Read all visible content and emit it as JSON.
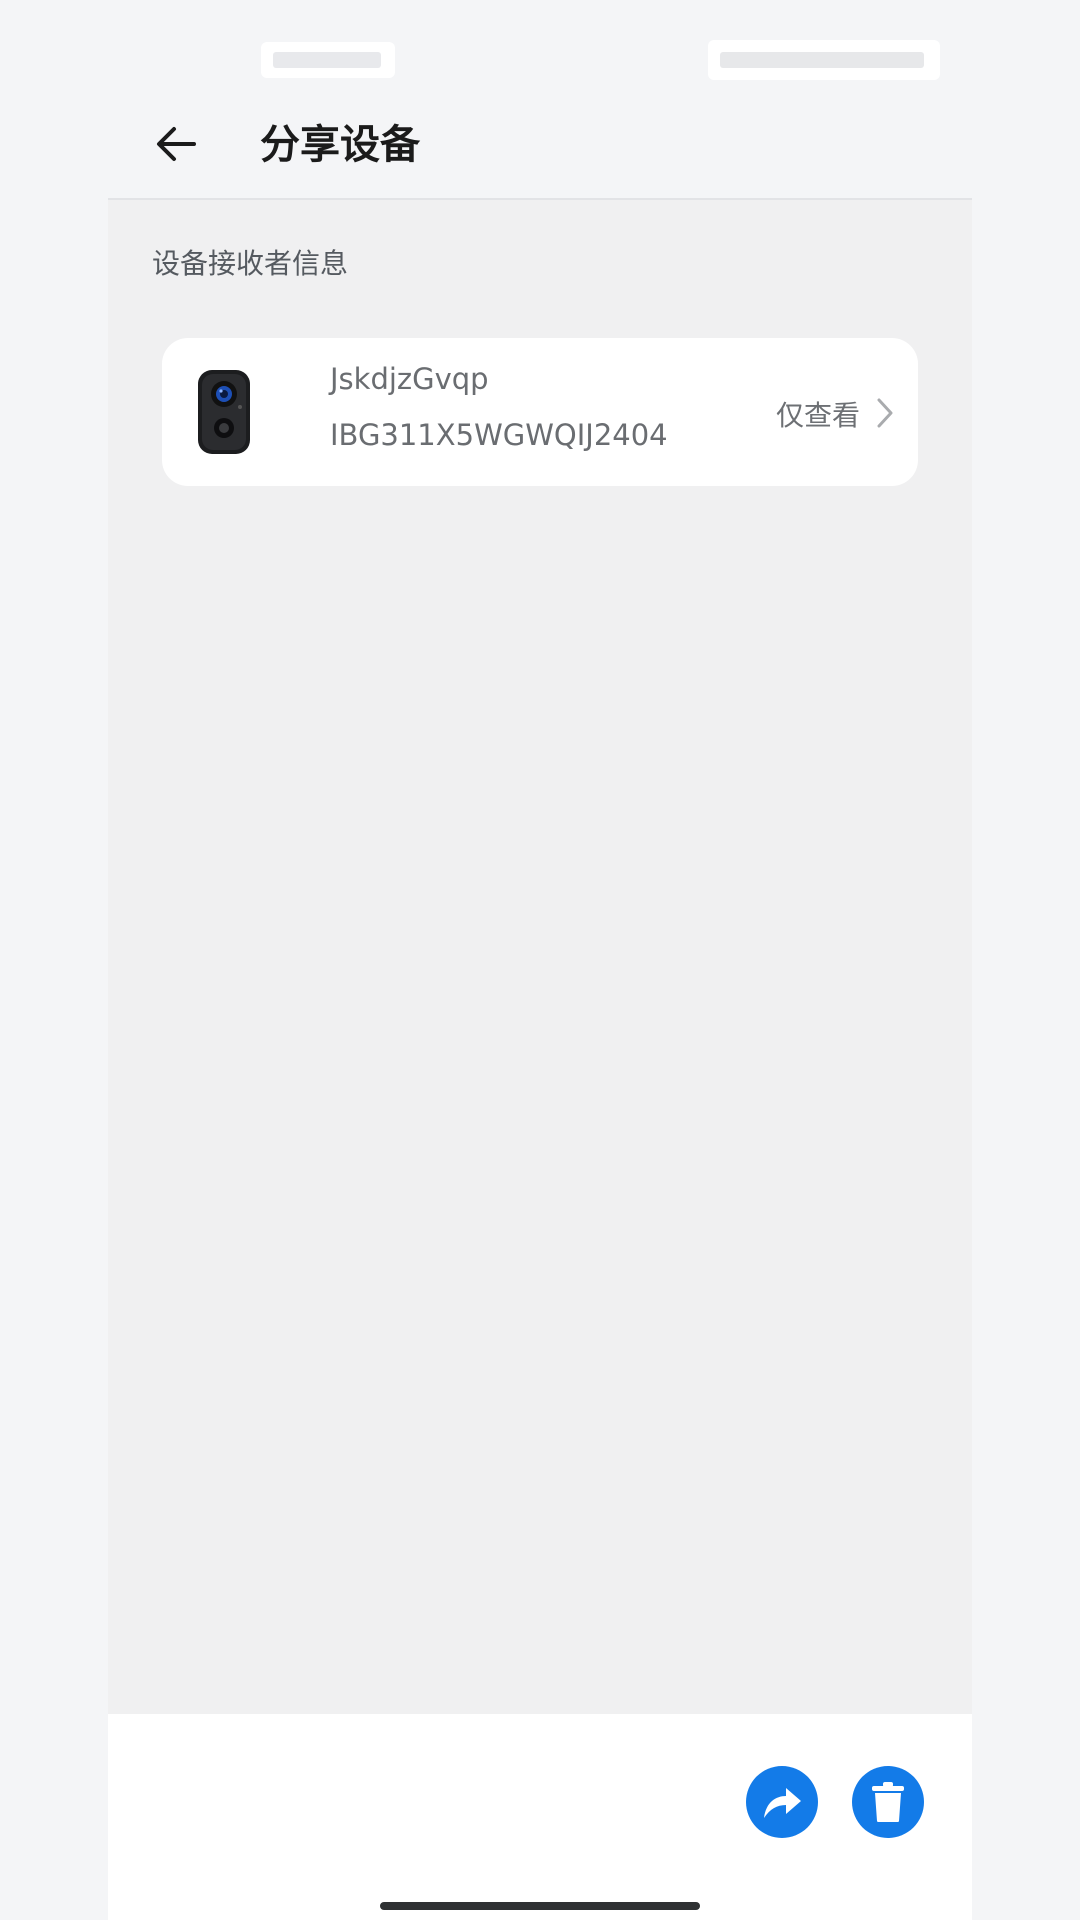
{
  "header": {
    "title": "分享设备",
    "back_icon": "arrow-left-icon"
  },
  "section": {
    "label": "设备接收者信息"
  },
  "device": {
    "name": "JskdjzGvqp",
    "serial": "IBG311X5WGWQIJ2404",
    "permission": "仅查看",
    "thumbnail_icon": "camera-icon"
  },
  "actions": {
    "share_icon": "share-arrow-icon",
    "delete_icon": "trash-icon",
    "accent_color": "#137be8"
  }
}
